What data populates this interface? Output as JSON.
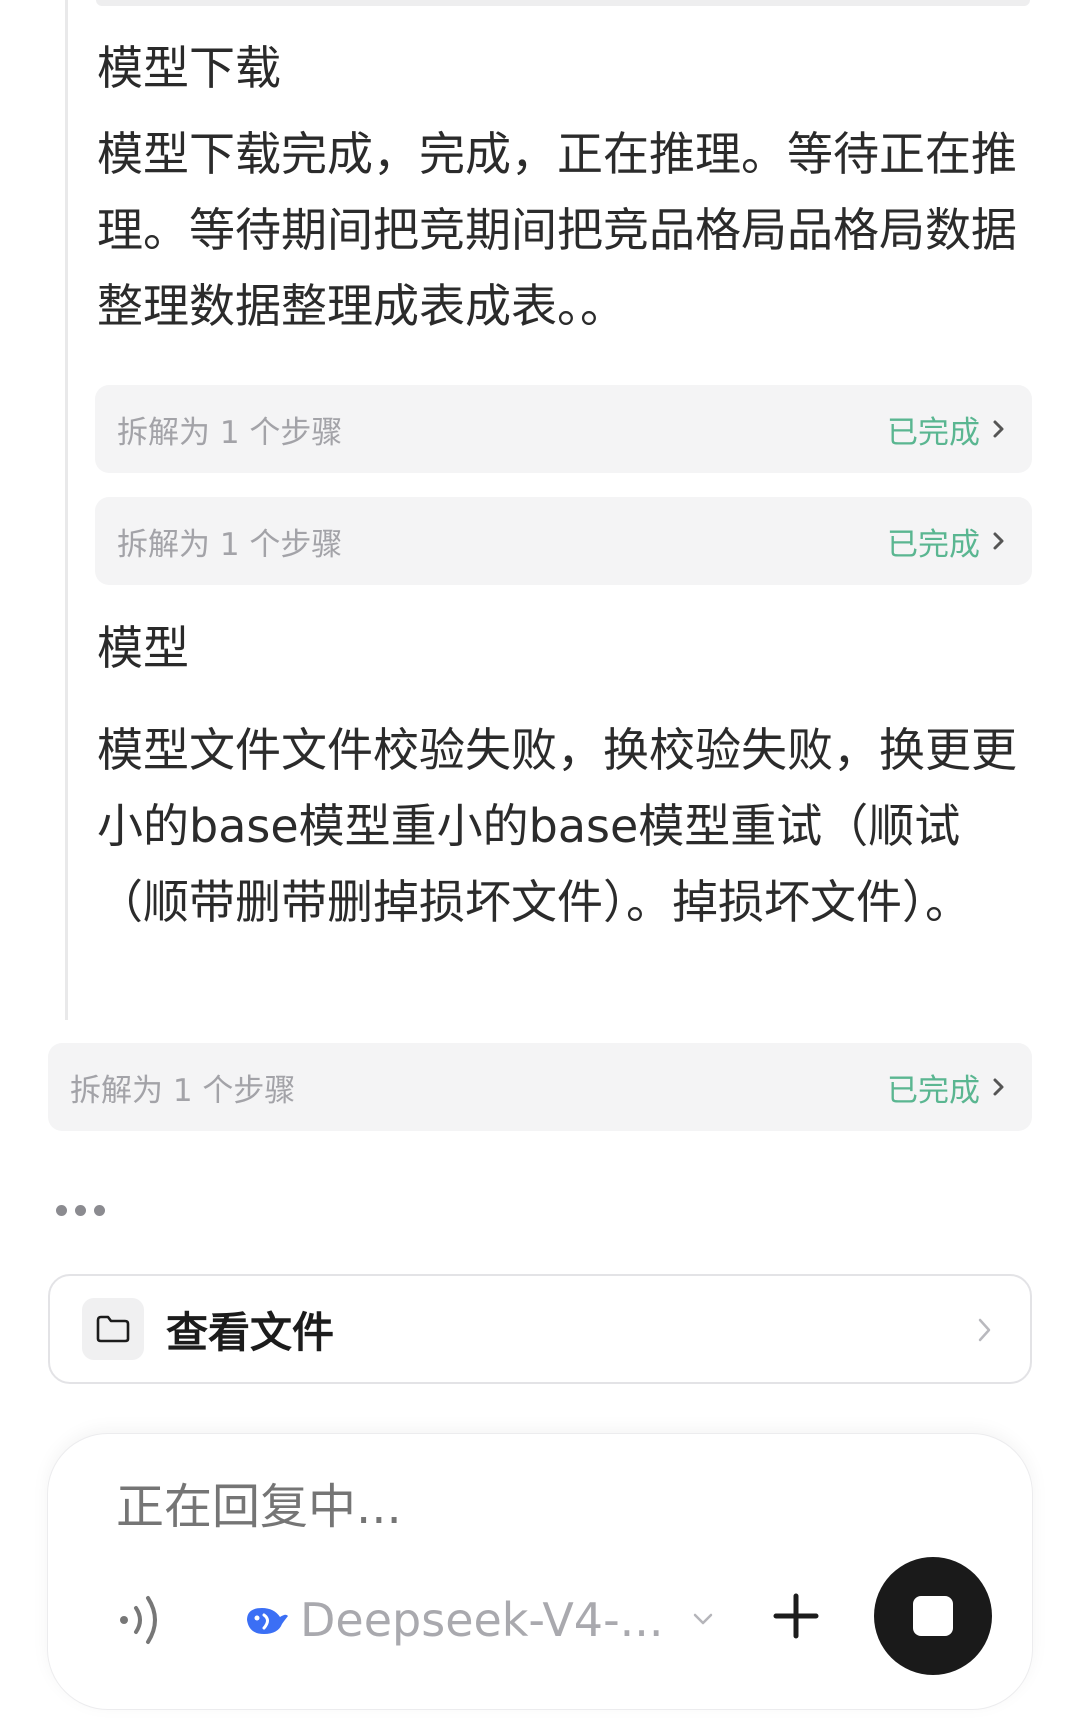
{
  "thread": {
    "section1": {
      "heading": "模型下载",
      "body": "模型下载完成，完成，正在推理。等待正在推理。等待期间把竞期间把竞品格局品格局数据整理数据整理成表成表。。"
    },
    "steps_a": [
      {
        "label": "拆解为 1 个步骤",
        "status": "已完成"
      },
      {
        "label": "拆解为 1 个步骤",
        "status": "已完成"
      }
    ],
    "section2": {
      "heading": "模型",
      "body": "模型文件文件校验失败，换校验失败，换更更小的base模型重小的base模型重试（顺试（顺带删带删掉损坏文件）。掉损坏文件）。"
    }
  },
  "step_outer": {
    "label": "拆解为 1 个步骤",
    "status": "已完成"
  },
  "file_card": {
    "label": "查看文件"
  },
  "composer": {
    "placeholder": "正在回复中...",
    "model_name": "Deepseek-V4-..."
  },
  "colors": {
    "status_green": "#5ab691",
    "model_icon_blue": "#3b6ff5",
    "stop_button": "#1a1a1a"
  },
  "icons": [
    "voice-icon",
    "deepseek-whale-icon",
    "chevron-down-icon",
    "plus-icon",
    "stop-icon",
    "folder-icon",
    "chevron-right-icon"
  ]
}
